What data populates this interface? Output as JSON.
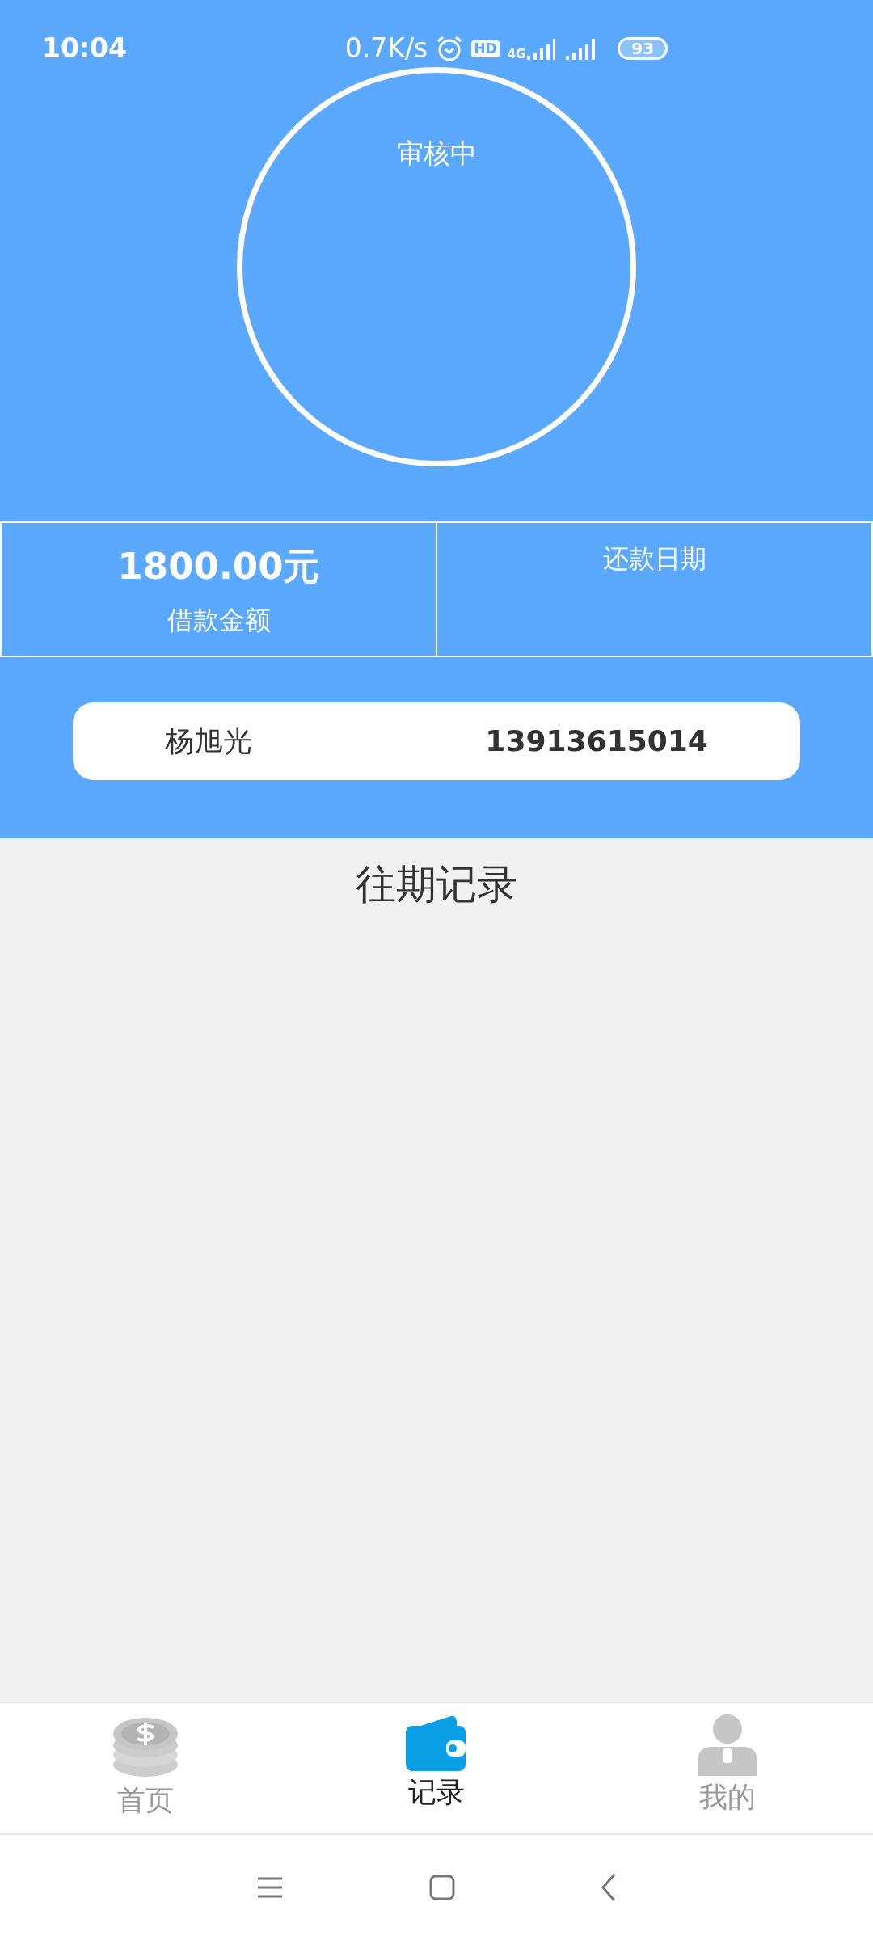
{
  "status_bar": {
    "time": "10:04",
    "network_speed": "0.7K/s",
    "hd_label": "HD",
    "network_type": "4G",
    "battery": "93"
  },
  "status_circle": {
    "label": "审核中"
  },
  "stats": [
    {
      "value": "1800.00元",
      "label": "借款金额"
    },
    {
      "label": "还款日期"
    }
  ],
  "user": {
    "name": "杨旭光",
    "phone": "13913615014"
  },
  "records": {
    "title": "往期记录"
  },
  "tabbar": [
    {
      "label": "首页",
      "kind": "coins",
      "selected": false
    },
    {
      "label": "记录",
      "kind": "wallet",
      "selected": true
    },
    {
      "label": "我的",
      "kind": "person",
      "selected": false
    }
  ]
}
